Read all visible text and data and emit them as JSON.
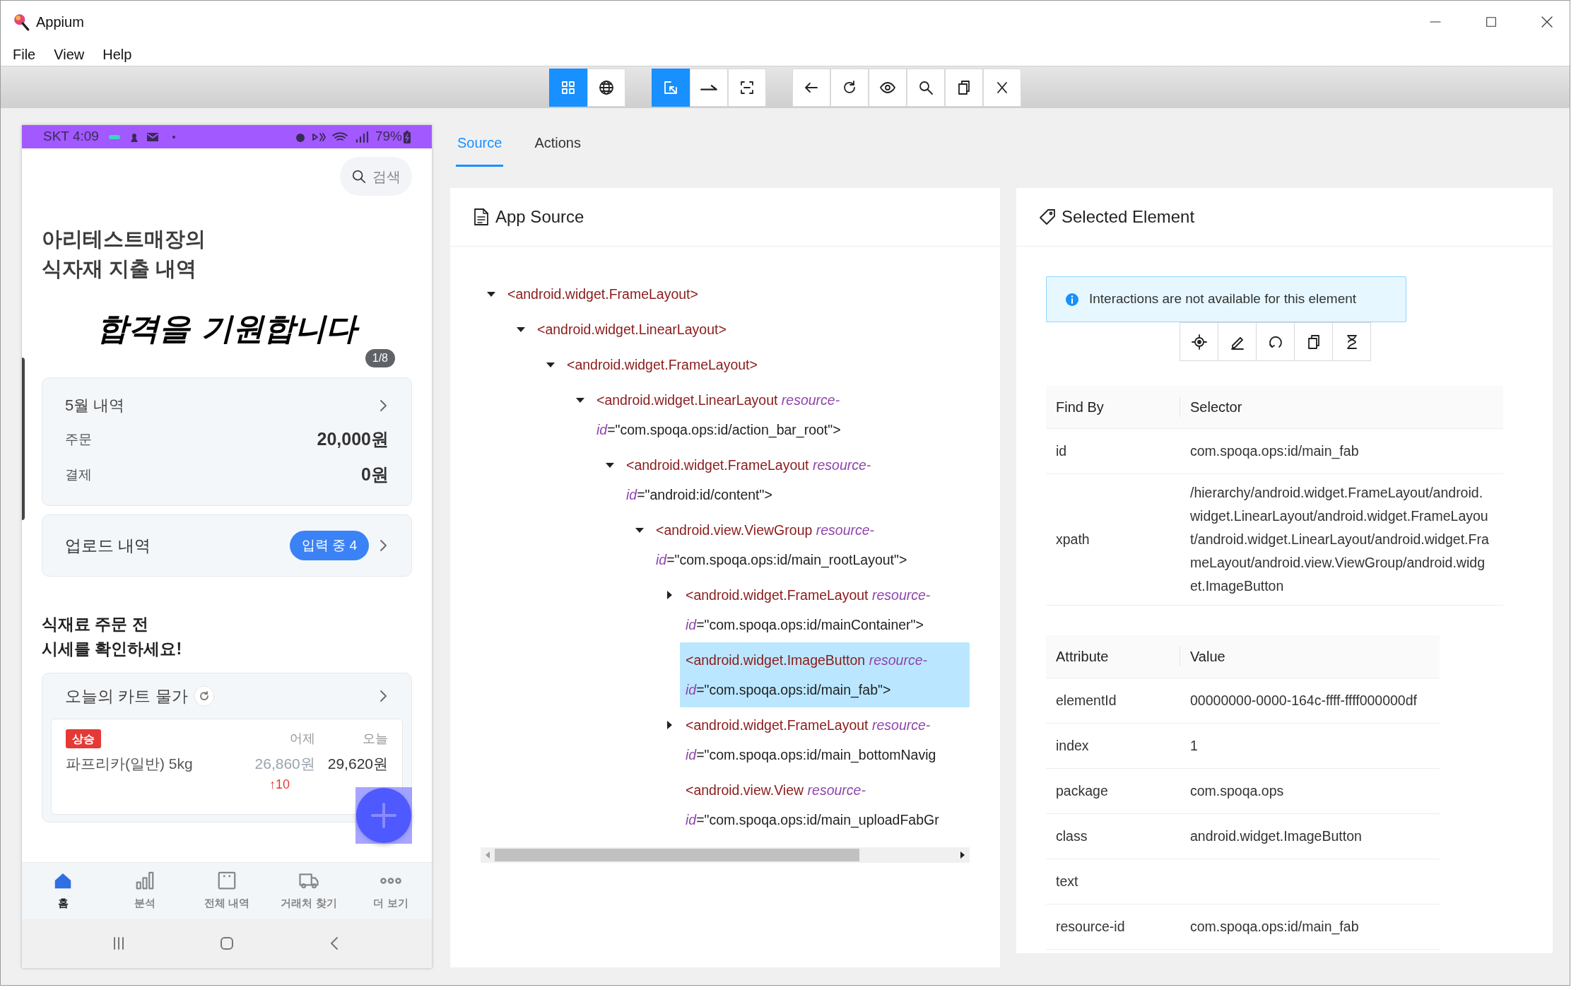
{
  "window": {
    "title": "Appium"
  },
  "menu": [
    "File",
    "View",
    "Help"
  ],
  "toolbar": {
    "groups": [
      [
        {
          "selected": true
        },
        {
          "selected": false
        }
      ],
      [
        {
          "selected": true
        },
        {
          "selected": false
        },
        {
          "selected": false
        }
      ]
    ]
  },
  "phone": {
    "status_bar": {
      "time": "SKT 4:09",
      "battery": "79%"
    },
    "search_button": "검색",
    "title_lines": [
      "아리테스트매장의",
      "식자재 지출 내역"
    ],
    "banner": {
      "text": "합격을 기원합니다",
      "page": "1/8"
    },
    "monthly_card": {
      "title": "5월 내역",
      "rows": [
        {
          "label": "주문",
          "value": "20,000원"
        },
        {
          "label": "결제",
          "value": "0원"
        }
      ]
    },
    "upload_card": {
      "title": "업로드 내역",
      "badge": "입력 중 4"
    },
    "price_heading": [
      "식재료 주문 전",
      "시세를 확인하세요!"
    ],
    "price_card": {
      "title": "오늘의 카트 물가",
      "item": {
        "tag": "상승",
        "name": "파프리카(일반) 5kg",
        "yesterday_label": "어제",
        "today_label": "오늘",
        "yesterday": "26,860원",
        "today": "29,620원",
        "change": "↑10"
      }
    },
    "bottom_nav": [
      {
        "label": "홈",
        "selected": true
      },
      {
        "label": "분석",
        "selected": false
      },
      {
        "label": "전체 내역",
        "selected": false
      },
      {
        "label": "거래처 찾기",
        "selected": false
      },
      {
        "label": "더 보기",
        "selected": false
      }
    ]
  },
  "tabs": [
    {
      "label": "Source",
      "selected": true
    },
    {
      "label": "Actions",
      "selected": false
    }
  ],
  "app_source": {
    "title": "App Source",
    "tree": [
      {
        "kind": "branch",
        "expanded": true,
        "selected": false,
        "tag": "<android.widget.FrameLayout>",
        "children": [
          {
            "kind": "branch",
            "expanded": true,
            "selected": false,
            "tag": "<android.widget.LinearLayout>",
            "children": [
              {
                "kind": "branch",
                "expanded": true,
                "selected": false,
                "tag": "<android.widget.FrameLayout>",
                "children": [
                  {
                    "kind": "branch",
                    "expanded": true,
                    "selected": false,
                    "tag": "<android.widget.LinearLayout",
                    "attr": "resource-id",
                    "value": "=\"com.spoqa.ops:id/action_bar_root\">",
                    "children": [
                      {
                        "kind": "branch",
                        "expanded": true,
                        "selected": false,
                        "tag": "<android.widget.FrameLayout",
                        "attr": "resource-id",
                        "value": "=\"android:id/content\">",
                        "children": [
                          {
                            "kind": "branch",
                            "expanded": true,
                            "selected": false,
                            "tag": "<android.view.ViewGroup",
                            "attr": "resource-id",
                            "value": "=\"com.spoqa.ops:id/main_rootLayout\">",
                            "children": [
                              {
                                "kind": "branch",
                                "expanded": false,
                                "selected": false,
                                "tag": "<android.widget.FrameLayout",
                                "attr": "resource-id",
                                "value": "=\"com.spoqa.ops:id/mainContainer\">"
                              },
                              {
                                "kind": "leaf",
                                "selected": true,
                                "tag": "<android.widget.ImageButton",
                                "attr": "resource-id",
                                "value": "=\"com.spoqa.ops:id/main_fab\">"
                              },
                              {
                                "kind": "branch",
                                "expanded": false,
                                "selected": false,
                                "tag": "<android.widget.FrameLayout",
                                "attr": "resource-id",
                                "value": "=\"com.spoqa.ops:id/main_bottomNavig"
                              },
                              {
                                "kind": "leaf",
                                "selected": false,
                                "tag": "<android.view.View",
                                "attr": "resource-id",
                                "value": "=\"com.spoqa.ops:id/main_uploadFabGr"
                              }
                            ]
                          }
                        ]
                      }
                    ]
                  }
                ]
              }
            ]
          }
        ]
      }
    ]
  },
  "selected_element": {
    "title": "Selected Element",
    "notice": "Interactions are not available for this element",
    "find_by": {
      "columns": [
        "Find By",
        "Selector"
      ],
      "rows": [
        [
          "id",
          "com.spoqa.ops:id/main_fab"
        ],
        [
          "xpath",
          "/hierarchy/android.widget.FrameLayout/android.widget.LinearLayout/android.widget.FrameLayout/android.widget.LinearLayout/android.widget.FrameLayout/android.view.ViewGroup/android.widget.ImageButton"
        ]
      ]
    },
    "attributes": {
      "columns": [
        "Attribute",
        "Value"
      ],
      "rows": [
        [
          "elementId",
          "00000000-0000-164c-ffff-ffff000000df"
        ],
        [
          "index",
          "1"
        ],
        [
          "package",
          "com.spoqa.ops"
        ],
        [
          "class",
          "android.widget.ImageButton"
        ],
        [
          "text"
        ],
        [
          "resource-id",
          "com.spoqa.ops:id/main_fab"
        ]
      ]
    }
  }
}
